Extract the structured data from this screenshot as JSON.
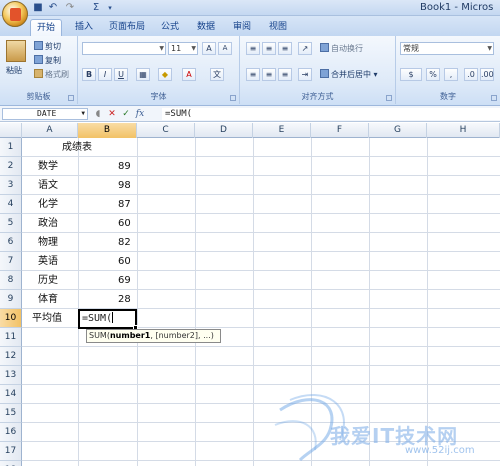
{
  "window": {
    "title": "Book1 - Micros"
  },
  "tabs": [
    {
      "label": "开始"
    },
    {
      "label": "插入"
    },
    {
      "label": "页面布局"
    },
    {
      "label": "公式"
    },
    {
      "label": "数据"
    },
    {
      "label": "审阅"
    },
    {
      "label": "视图"
    }
  ],
  "ribbon": {
    "clipboard": {
      "label": "剪贴板",
      "paste": "粘贴",
      "cut": "剪切",
      "copy": "复制",
      "format_painter": "格式刷"
    },
    "font": {
      "label": "字体",
      "size": "11"
    },
    "alignment": {
      "label": "对齐方式",
      "wrap": "自动换行",
      "merge": "合并后居中"
    },
    "number": {
      "label": "数字",
      "format": "常规"
    }
  },
  "formula_bar": {
    "name_box": "DATE",
    "fx": "fx",
    "content": "=SUM("
  },
  "columns": [
    "A",
    "B",
    "C",
    "D",
    "E",
    "F",
    "G",
    "H"
  ],
  "rows": [
    "1",
    "2",
    "3",
    "4",
    "5",
    "6",
    "7",
    "8",
    "9",
    "10",
    "11",
    "12",
    "13",
    "14",
    "15",
    "16",
    "17",
    "18"
  ],
  "sheet": {
    "title": "成绩表",
    "subjects": [
      {
        "name": "数学",
        "score": "89"
      },
      {
        "name": "语文",
        "score": "98"
      },
      {
        "name": "化学",
        "score": "87"
      },
      {
        "name": "政治",
        "score": "60"
      },
      {
        "name": "物理",
        "score": "82"
      },
      {
        "name": "英语",
        "score": "60"
      },
      {
        "name": "历史",
        "score": "69"
      },
      {
        "name": "体育",
        "score": "28"
      }
    ],
    "average_label": "平均值",
    "editing_cell": {
      "ref": "B10",
      "value": "=SUM("
    },
    "tooltip": {
      "func": "SUM(",
      "arg1": "number1",
      "rest": ", [number2], ...)"
    }
  },
  "watermark": {
    "text": "我爱IT技术网",
    "url": "www.52ij.com"
  }
}
